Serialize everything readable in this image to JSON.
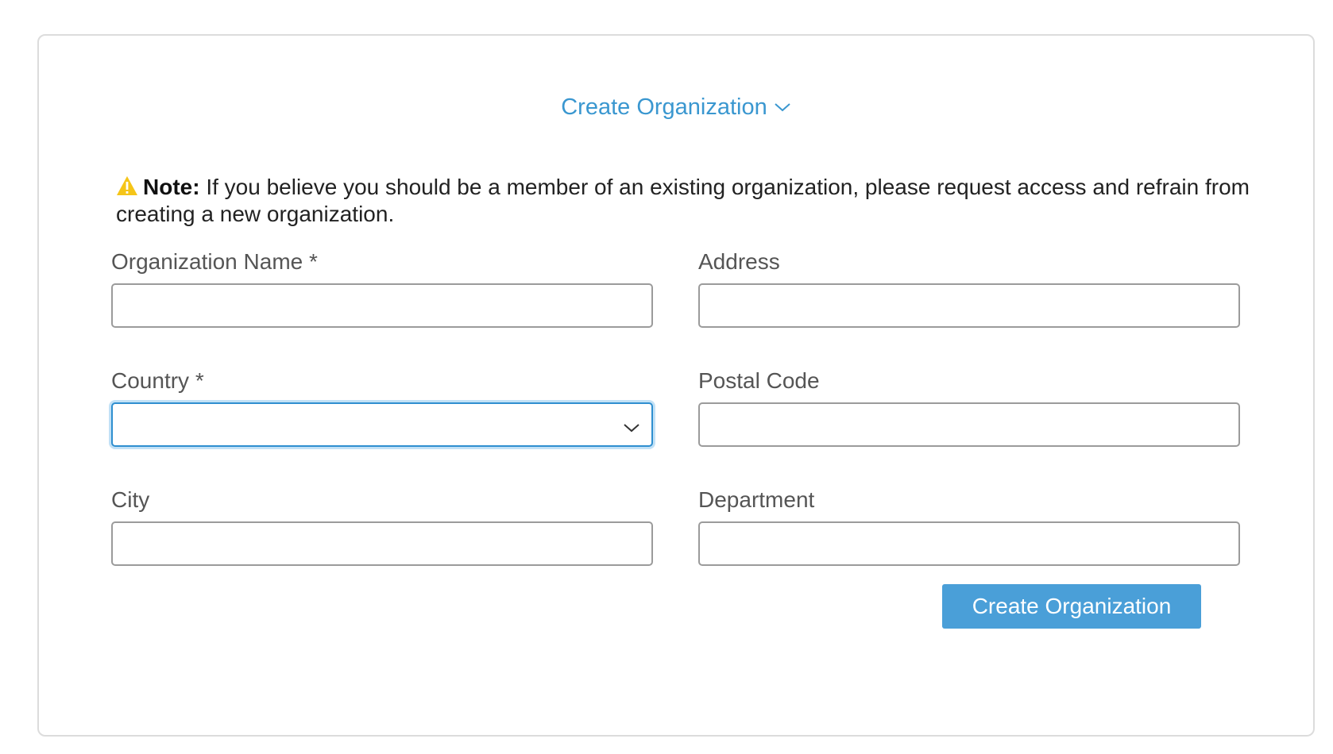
{
  "section": {
    "toggle_label": "Create Organization"
  },
  "note": {
    "label": "Note:",
    "text": " If you believe you should be a member of an existing organization, please request access and refrain from creating a new organization."
  },
  "form": {
    "organization_name": {
      "label": "Organization Name *",
      "value": ""
    },
    "address": {
      "label": "Address",
      "value": ""
    },
    "country": {
      "label": "Country *",
      "value": ""
    },
    "postal_code": {
      "label": "Postal Code",
      "value": ""
    },
    "city": {
      "label": "City",
      "value": ""
    },
    "department": {
      "label": "Department",
      "value": ""
    },
    "submit_label": "Create Organization"
  },
  "colors": {
    "accent": "#3a97d0",
    "button": "#4a9fd8",
    "warning": "#f5c518"
  },
  "icons": {
    "toggle": "chevron-down-icon",
    "note": "warning-icon",
    "select": "chevron-down-icon"
  }
}
